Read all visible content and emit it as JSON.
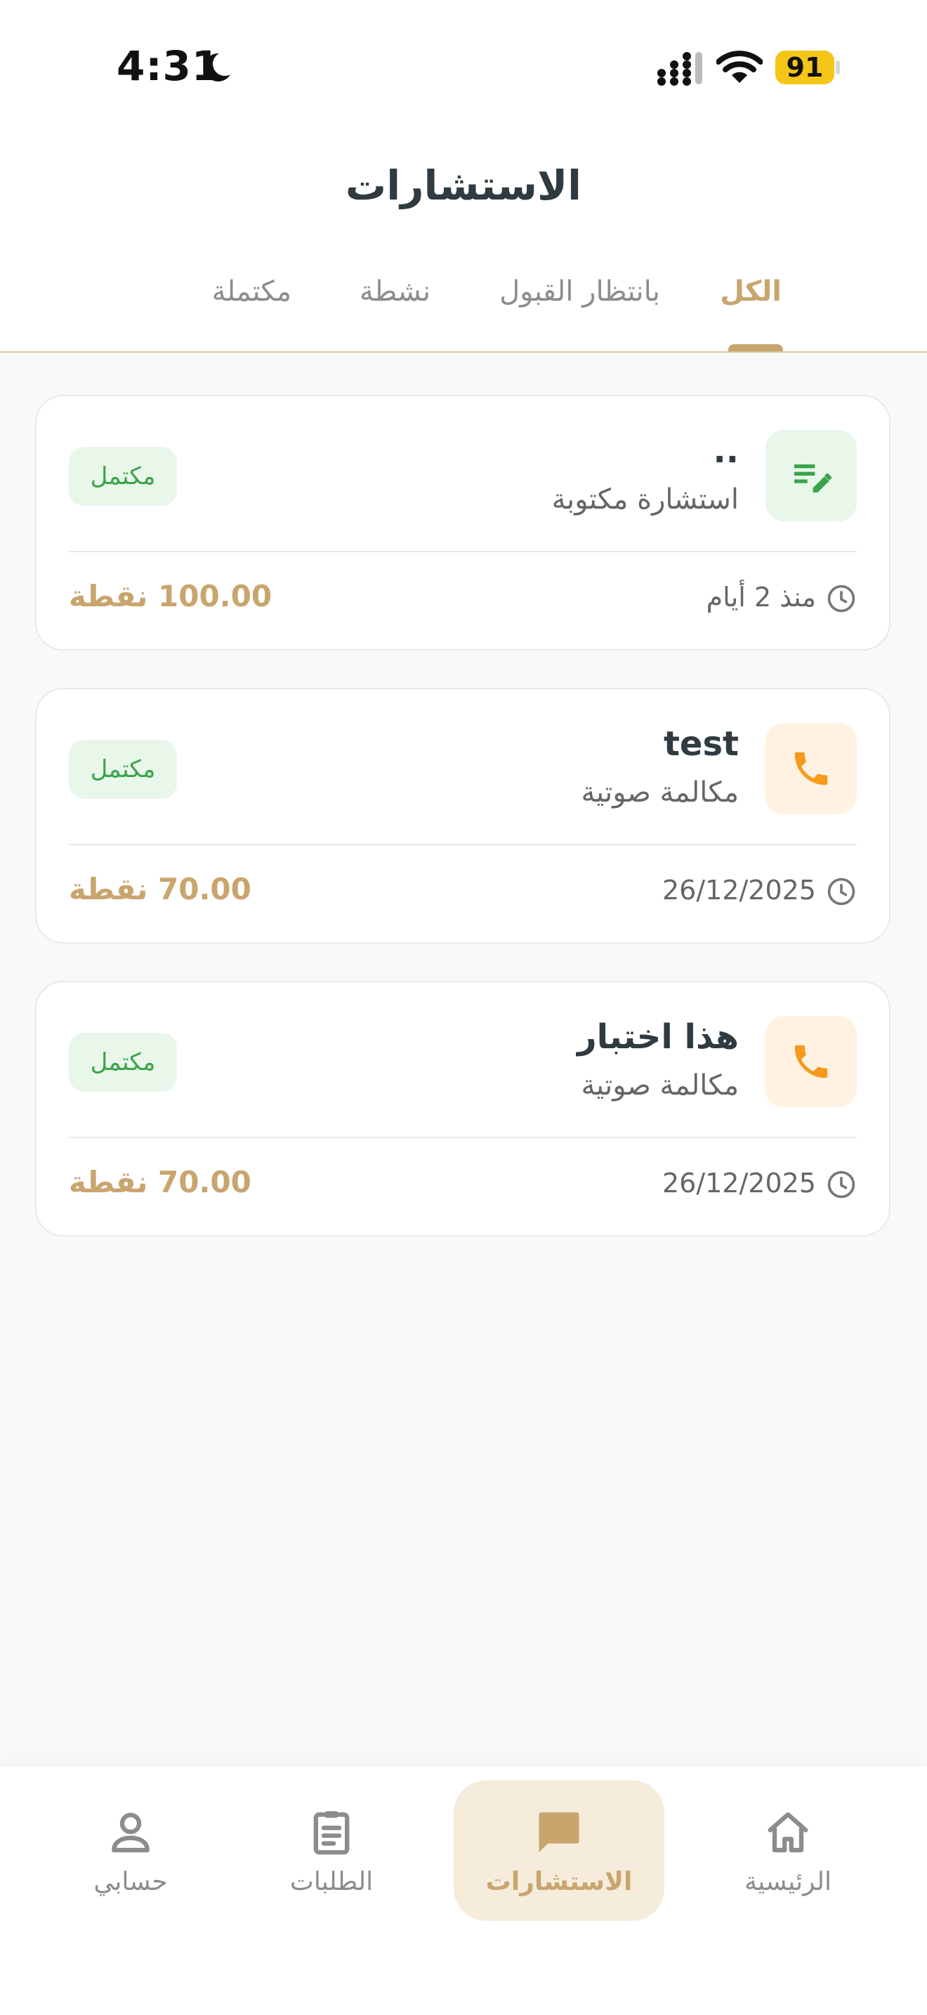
{
  "status_bar": {
    "time": "4:31",
    "battery": "91"
  },
  "header": {
    "title": "الاستشارات",
    "tabs": [
      {
        "label": "الكل",
        "active": true
      },
      {
        "label": "بانتظار القبول",
        "active": false
      },
      {
        "label": "نشطة",
        "active": false
      },
      {
        "label": "مكتملة",
        "active": false
      }
    ]
  },
  "consultations": [
    {
      "title": "..",
      "type": "استشارة مكتوبة",
      "icon": "edit-note-icon",
      "status": "مكتمل",
      "date": "منذ 2 أيام",
      "price": "100.00 نقطة"
    },
    {
      "title": "test",
      "type": "مكالمة صوتية",
      "icon": "phone-icon",
      "status": "مكتمل",
      "date": "26/12/2025",
      "price": "70.00 نقطة"
    },
    {
      "title": "هذا اختبار",
      "type": "مكالمة صوتية",
      "icon": "phone-icon",
      "status": "مكتمل",
      "date": "26/12/2025",
      "price": "70.00 نقطة"
    }
  ],
  "bottom_nav": {
    "items": [
      {
        "label": "الرئيسية",
        "icon": "home-icon",
        "active": false
      },
      {
        "label": "الاستشارات",
        "icon": "chat-icon",
        "active": true
      },
      {
        "label": "الطلبات",
        "icon": "clipboard-icon",
        "active": false
      },
      {
        "label": "حسابي",
        "icon": "person-icon",
        "active": false
      }
    ]
  },
  "colors": {
    "accent": "#c9a56e",
    "success": "#3aa44a",
    "success_bg": "#e9f6ea",
    "call": "#f59a1b",
    "call_bg": "#fff2e2",
    "text_dark": "#2f3b40"
  }
}
